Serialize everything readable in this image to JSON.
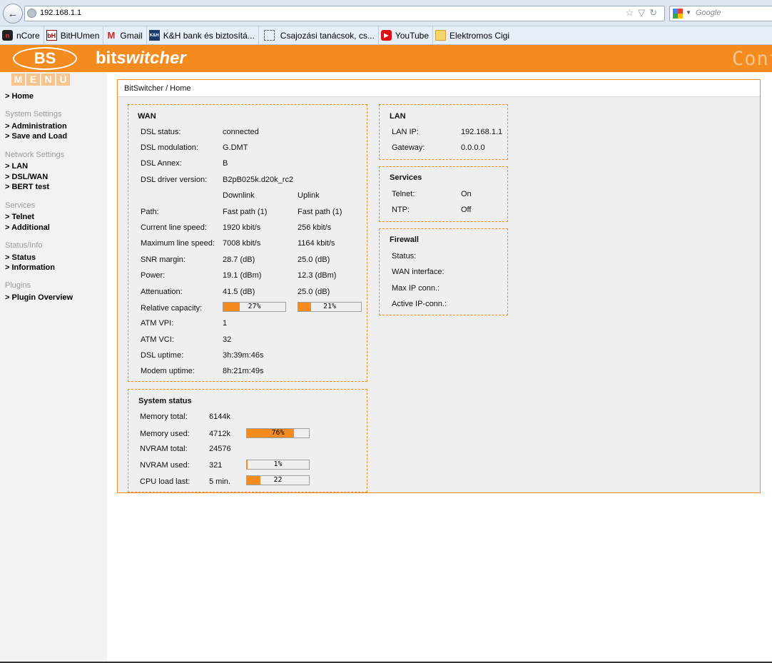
{
  "browser": {
    "url": "192.168.1.1",
    "search_placeholder": "Google",
    "bookmarks": [
      {
        "label": "nCore",
        "icon": "ncore-icon"
      },
      {
        "label": "BitHUmen",
        "icon": "bithumen-icon"
      },
      {
        "label": "Gmail",
        "icon": "gmail-icon"
      },
      {
        "label": "K&H bank és biztosítá...",
        "icon": "kh-bank-icon"
      },
      {
        "label": "Csajozási tanácsok, cs...",
        "icon": "page-icon"
      },
      {
        "label": "YouTube",
        "icon": "youtube-icon"
      },
      {
        "label": "Elektromos Cigi",
        "icon": "folder-icon"
      }
    ]
  },
  "header": {
    "logo": "BS",
    "brand_bold": "bit",
    "brand_italic": "switcher",
    "right_text": "Cont",
    "accent": "#f38b1f"
  },
  "sidebar": {
    "menu_letters": [
      "M",
      "E",
      "N",
      "Ü"
    ],
    "home": "> Home",
    "sections": [
      {
        "heading": "System Settings",
        "items": [
          "> Administration",
          "> Save and Load"
        ]
      },
      {
        "heading": "Network Settings",
        "items": [
          "> LAN",
          "> DSL/WAN",
          "> BERT test"
        ]
      },
      {
        "heading": "Services",
        "items": [
          "> Telnet",
          "> Additional"
        ]
      },
      {
        "heading": "Status/Info",
        "items": [
          "> Status",
          "> Information"
        ]
      },
      {
        "heading": "Plugins",
        "items": [
          "> Plugin Overview"
        ]
      }
    ]
  },
  "breadcrumb": "BitSwitcher / Home",
  "wan": {
    "title": "WAN",
    "dsl_status": {
      "label": "DSL status:",
      "value": "connected"
    },
    "dsl_modulation": {
      "label": "DSL modulation:",
      "value": "G.DMT"
    },
    "dsl_annex": {
      "label": "DSL Annex:",
      "value": "B"
    },
    "driver": {
      "label": "DSL driver version:",
      "value": "B2pB025k.d20k_rc2"
    },
    "col_down": "Downlink",
    "col_up": "Uplink",
    "rows": [
      {
        "label": "Path:",
        "down": "Fast path (1)",
        "up": "Fast path (1)"
      },
      {
        "label": "Current line speed:",
        "down": "1920 kbit/s",
        "up": "256 kbit/s"
      },
      {
        "label": "Maximum line speed:",
        "down": "7008 kbit/s",
        "up": "1164 kbit/s"
      },
      {
        "label": "SNR margin:",
        "down": "28.7 (dB)",
        "up": "25.0 (dB)"
      },
      {
        "label": "Power:",
        "down": "19.1 (dBm)",
        "up": "12.3 (dBm)"
      },
      {
        "label": "Attenuation:",
        "down": "41.5 (dB)",
        "up": "25.0 (dB)"
      }
    ],
    "capacity": {
      "label": "Relative capacity:",
      "down_pct": 27,
      "down_text": "27%",
      "up_pct": 21,
      "up_text": "21%"
    },
    "tail_rows": [
      {
        "label": "ATM VPI:",
        "value": "1"
      },
      {
        "label": "ATM VCI:",
        "value": "32"
      },
      {
        "label": "DSL uptime:",
        "value": "3h:39m:46s"
      },
      {
        "label": "Modem uptime:",
        "value": "8h:21m:49s"
      }
    ]
  },
  "system": {
    "title": "System status",
    "mem_total": {
      "label": "Memory total:",
      "value": "6144k"
    },
    "mem_used": {
      "label": "Memory used:",
      "value": "4712k",
      "pct": 76,
      "bar_text": "76%"
    },
    "nvram_total": {
      "label": "NVRAM total:",
      "value": "24576"
    },
    "nvram_used": {
      "label": "NVRAM used:",
      "value": "321",
      "pct": 1,
      "bar_text": "1%"
    },
    "cpu": {
      "label": "CPU load last:",
      "value": "5 min.",
      "pct": 22,
      "bar_text": "22"
    }
  },
  "lan": {
    "title": "LAN",
    "ip": {
      "label": "LAN IP:",
      "value": "192.168.1.1"
    },
    "gateway": {
      "label": "Gateway:",
      "value": "0.0.0.0"
    }
  },
  "services": {
    "title": "Services",
    "telnet": {
      "label": "Telnet:",
      "value": "On"
    },
    "ntp": {
      "label": "NTP:",
      "value": "Off"
    }
  },
  "firewall": {
    "title": "Firewall",
    "rows": [
      "Status:",
      "WAN interface:",
      "Max IP conn.:",
      "Active IP-conn.:"
    ]
  }
}
